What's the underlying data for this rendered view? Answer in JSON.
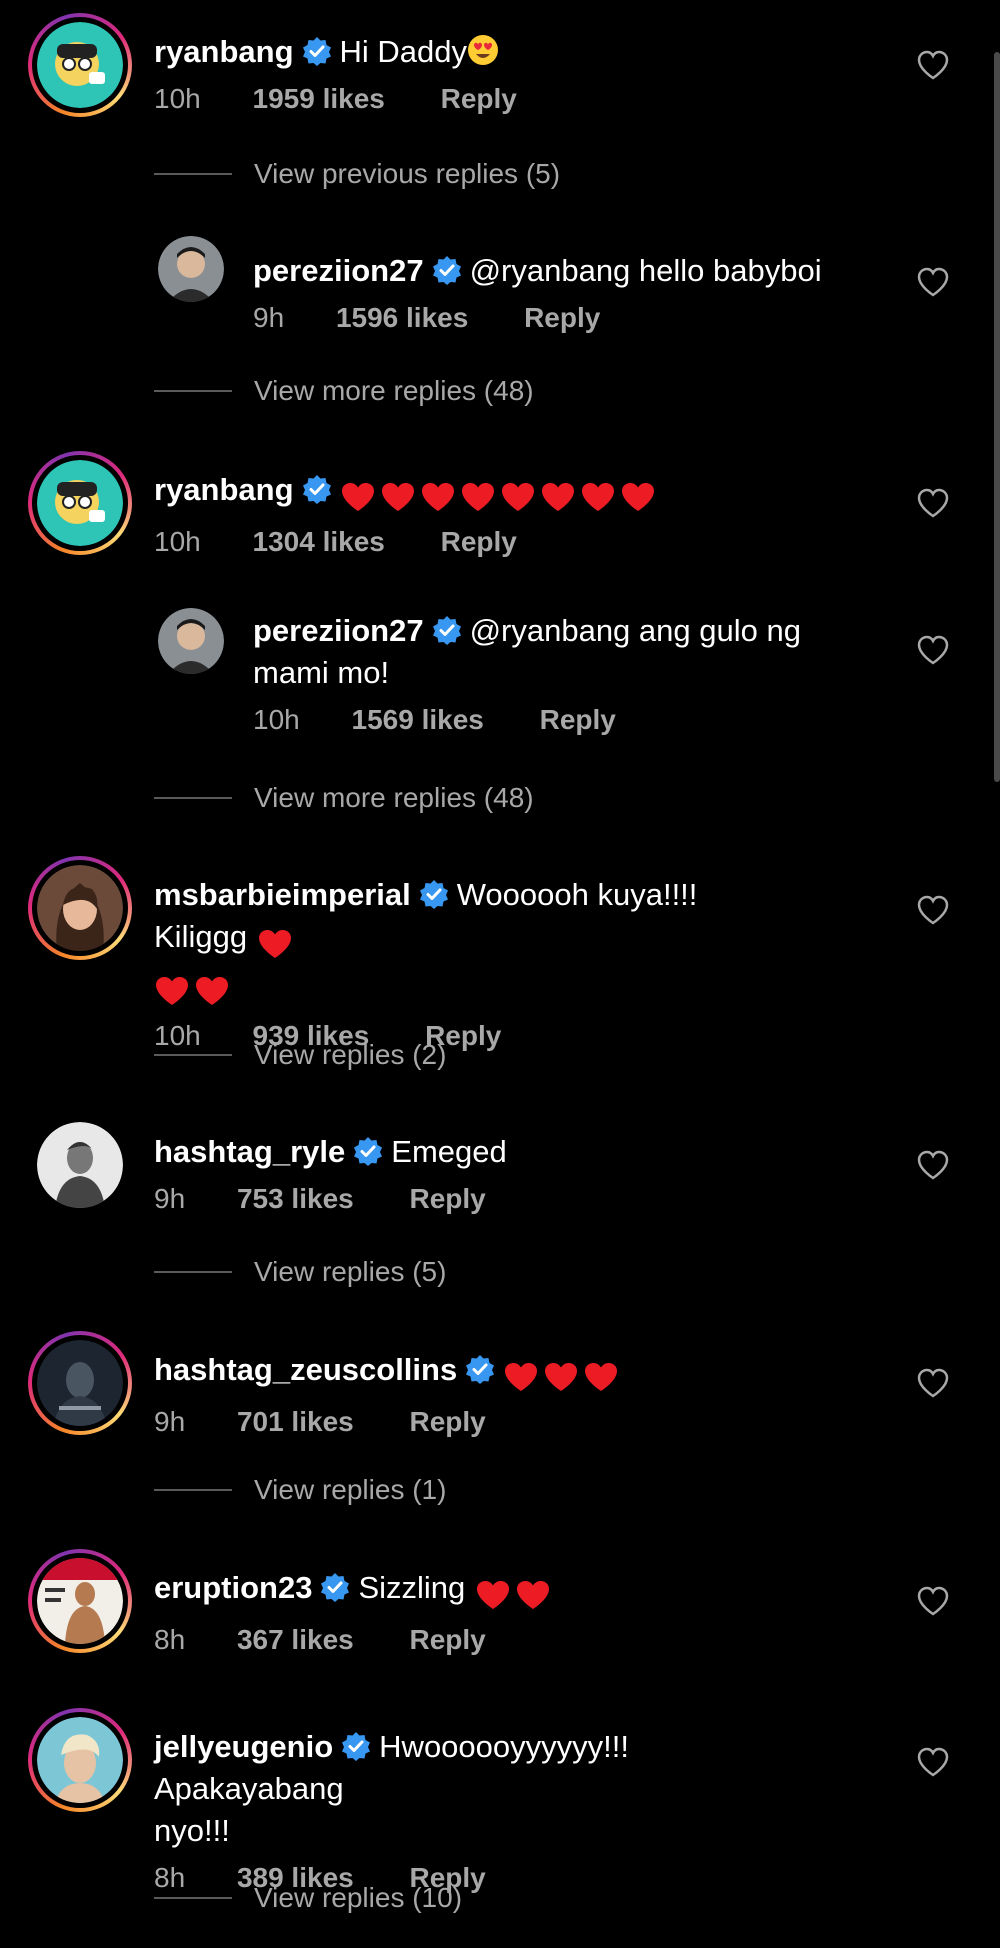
{
  "colors": {
    "background": "#000000",
    "text": "#ffffff",
    "muted": "#a8a8a8",
    "verified_blue": "#3897f0",
    "heart_red": "#ed1c24",
    "story_ring": "#dd2a7b"
  },
  "comments": [
    {
      "username": "ryanbang",
      "verified": true,
      "text": "Hi Daddy",
      "emoji": "heart-eyes-emoji",
      "time": "10h",
      "likes": "1959 likes",
      "reply_label": "Reply",
      "avatar_icon": "cartoon-avatar-icon"
    },
    {
      "view_replies": "View previous replies (5)"
    },
    {
      "username": "pereziion27",
      "verified": true,
      "text": "@ryanbang hello babyboi",
      "time": "9h",
      "likes": "1596 likes",
      "reply_label": "Reply"
    },
    {
      "view_replies": "View more replies (48)"
    },
    {
      "username": "ryanbang",
      "verified": true,
      "text": "",
      "hearts": 8,
      "time": "10h",
      "likes": "1304 likes",
      "reply_label": "Reply"
    },
    {
      "username": "pereziion27",
      "verified": true,
      "text_line1": "@ryanbang ang gulo ng",
      "text_line2": "mami mo!",
      "time": "10h",
      "likes": "1569 likes",
      "reply_label": "Reply"
    },
    {
      "view_replies": "View more replies (48)"
    },
    {
      "username": "msbarbieimperial",
      "verified": true,
      "text": "Woooooh kuya!!!! Kiliggg",
      "hearts": 3,
      "time": "10h",
      "likes": "939 likes",
      "reply_label": "Reply"
    },
    {
      "view_replies": "View replies (2)"
    },
    {
      "username": "hashtag_ryle",
      "verified": true,
      "text": "Emeged",
      "time": "9h",
      "likes": "753 likes",
      "reply_label": "Reply"
    },
    {
      "view_replies": "View replies (5)"
    },
    {
      "username": "hashtag_zeuscollins",
      "verified": true,
      "text": "",
      "hearts": 3,
      "time": "9h",
      "likes": "701 likes",
      "reply_label": "Reply"
    },
    {
      "view_replies": "View replies (1)"
    },
    {
      "username": "eruption23",
      "verified": true,
      "text": "Sizzling",
      "hearts": 2,
      "time": "8h",
      "likes": "367 likes",
      "reply_label": "Reply"
    },
    {
      "username": "jellyeugenio",
      "verified": true,
      "text_line1": "Hwoooooyyyyyy!!! Apakayabang",
      "text_line2": "nyo!!!",
      "time": "8h",
      "likes": "389 likes",
      "reply_label": "Reply"
    },
    {
      "view_replies": "View replies (10)"
    }
  ]
}
